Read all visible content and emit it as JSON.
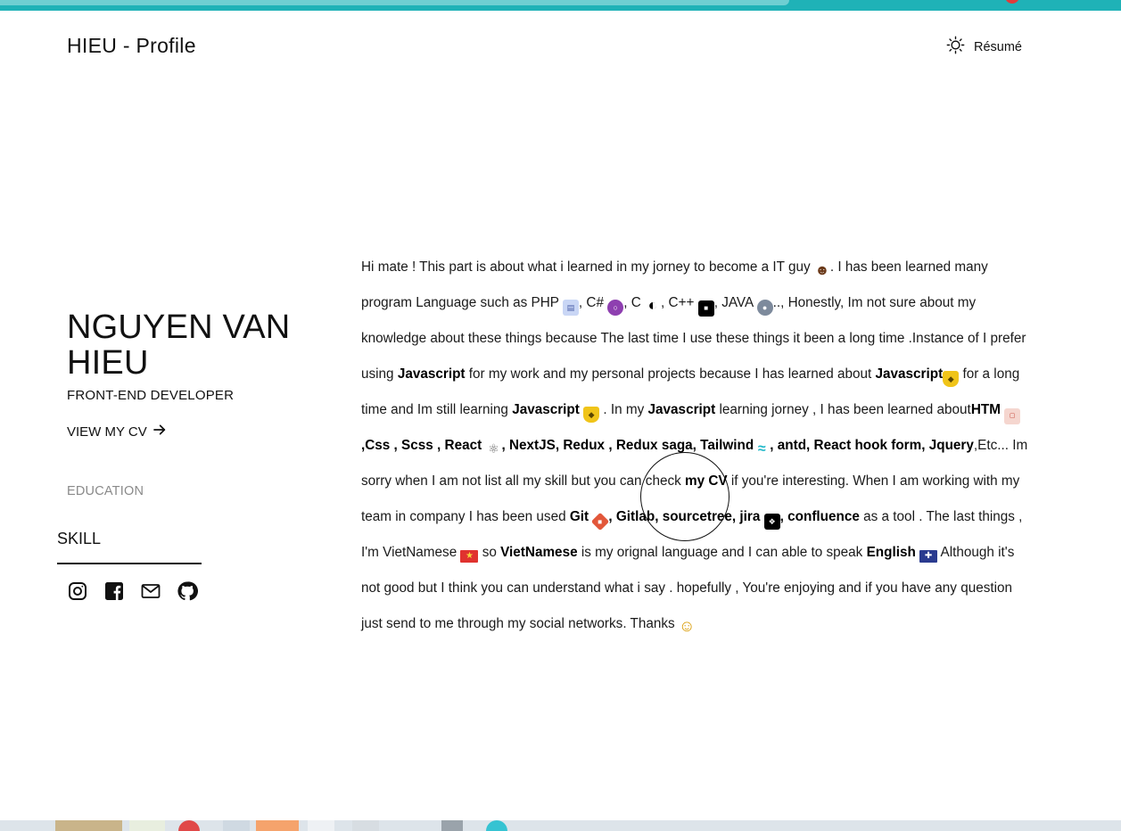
{
  "header": {
    "brand": "HIEU - Profile",
    "resume_label": "Résumé",
    "resume_icon": "sun-icon"
  },
  "profile": {
    "name": "NGUYEN VAN HIEU",
    "role": "FRONT-END DEVELOPER",
    "view_cv_label": "VIEW MY CV",
    "view_cv_icon": "arrow-right-icon"
  },
  "nav": {
    "education": "EDUCATION",
    "skill": "SKILL"
  },
  "socials": [
    {
      "icon": "instagram-icon"
    },
    {
      "icon": "facebook-icon"
    },
    {
      "icon": "mail-icon"
    },
    {
      "icon": "github-icon"
    }
  ],
  "about": {
    "t01": "Hi mate ! This part is about what i learned in my jorney to become a IT guy ",
    "t02": ". I has been learned many program Language such as PHP ",
    "t03": ", C# ",
    "t04": ", C ",
    "t05": ", C++ ",
    "t06": ", JAVA ",
    "t07": ".., Honestly, Im not sure about my knowledge about these things because The last time I use these things it been a long time .Instance of I prefer using ",
    "b01": "Javascript",
    "t08": " for my work and my personal projects because I has learned about ",
    "b02": "Javascript",
    "t09": "  for a long time and Im still learning ",
    "b03": "Javascript",
    "t10": "  . In my ",
    "b04": "Javascript",
    "t11": " learning jorney , I has been learned about",
    "b05": "HTM",
    "b06": ",Css , Scss , React ",
    "b07": ", NextJS, Redux , Redux saga, Tailwind",
    "b08": ", antd, React hook form, Jquery",
    "t12": ",Etc... Im sorry when I am not list all my skill but you can check ",
    "b09": "my CV",
    "t13": " if you're interesting. When I am working with my team in company I has been used ",
    "b10": "Git",
    "b11": ", Gitlab, sourcetree, jira ",
    "b12": ", confluence",
    "t14": " as a tool . The last things , I'm VietNamese ",
    "t15": " so ",
    "b13": "VietNamese",
    "t16": " is my orignal language and I can able to speak ",
    "b14": "English",
    "t17": " Although it's not good but I think you can understand what i say . hopefully , You're enjoying and if you have any question just send to me through my social networks. Thanks ",
    "icons": [
      "guy-icon",
      "php-icon",
      "csharp-icon",
      "c-icon",
      "cpp-icon",
      "java-icon",
      "javascript-icon",
      "html-icon",
      "react-icon",
      "tailwind-icon",
      "git-icon",
      "jira-icon",
      "vietnam-flag-icon",
      "uk-flag-icon",
      "smile-icon"
    ]
  },
  "colors": {
    "accent": "#1fb2b7",
    "text": "#111111",
    "muted": "#8a8a8a"
  }
}
